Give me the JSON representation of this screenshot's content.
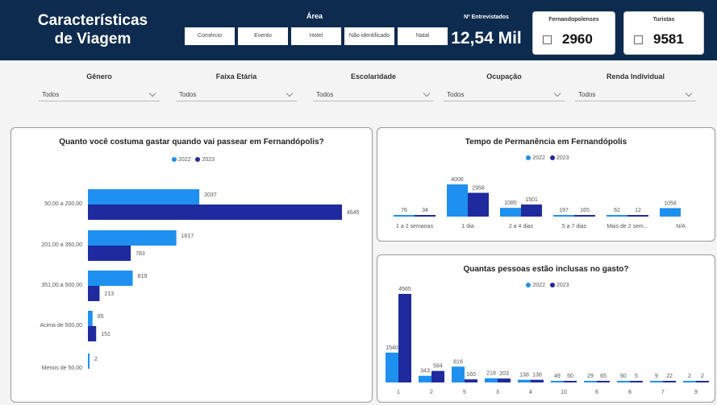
{
  "header": {
    "title": "Características de Viagem",
    "area_label": "Área",
    "area_options": [
      "Comércio",
      "Evento",
      "Hotel",
      "Não identificado",
      "Natal"
    ],
    "kpi_label": "Nº Entrevistados",
    "kpi_value": "12,54 Mil",
    "cards": [
      {
        "title": "Fernandopolenses",
        "value": "2960"
      },
      {
        "title": "Turistas",
        "value": "9581"
      }
    ]
  },
  "filters": [
    {
      "label": "Gênero",
      "value": "Todos"
    },
    {
      "label": "Faixa Etária",
      "value": "Todos"
    },
    {
      "label": "Escolaridade",
      "value": "Todos"
    },
    {
      "label": "Ocupação",
      "value": "Todos"
    },
    {
      "label": "Renda Individual",
      "value": "Todos"
    }
  ],
  "colors": {
    "series_2022": "#1e90ef",
    "series_2023": "#1f2a9e",
    "header_bg": "#0d2b4e"
  },
  "legend": [
    "2022",
    "2023"
  ],
  "chart_data": [
    {
      "type": "bar",
      "orientation": "horizontal",
      "title": "Quanto você costuma gastar quando vai passear em Fernandópolis?",
      "categories": [
        "50,00 a 200,00",
        "201,00 a 350,00",
        "351,00 a 500,00",
        "Acima de 500,00",
        "Menos de 50,00"
      ],
      "series": [
        {
          "name": "2022",
          "values": [
            2037,
            1617,
            819,
            85,
            2
          ]
        },
        {
          "name": "2023",
          "values": [
            4645,
            783,
            213,
            151,
            0
          ]
        }
      ],
      "data_labels": [
        [
          "2037",
          "1617",
          "819",
          "85",
          "2"
        ],
        [
          "4645",
          "783",
          "213",
          "151",
          ""
        ]
      ]
    },
    {
      "type": "bar",
      "title": "Tempo de Permanência em Fernandópolis",
      "categories": [
        "1 a 2 semanas",
        "1 dia",
        "2 a 4 dias",
        "5 a 7 dias",
        "Mais de 2 sem...",
        "N/A"
      ],
      "series": [
        {
          "name": "2022",
          "values": [
            76,
            4006,
            1085,
            197,
            62,
            1058
          ]
        },
        {
          "name": "2023",
          "values": [
            34,
            2958,
            1501,
            165,
            12,
            0
          ]
        }
      ],
      "data_labels": [
        [
          "76",
          "4006",
          "1085",
          "197",
          "62",
          "1058"
        ],
        [
          "34",
          "2958",
          "1501",
          "165",
          "12",
          ""
        ]
      ]
    },
    {
      "type": "bar",
      "title": "Quantas pessoas estão inclusas no gasto?",
      "categories": [
        "1",
        "2",
        "5",
        "3",
        "4",
        "10",
        "6",
        "8",
        "7",
        "9"
      ],
      "series": [
        {
          "name": "2022",
          "values": [
            1540,
            343,
            816,
            218,
            138,
            49,
            29,
            60,
            9,
            2
          ]
        },
        {
          "name": "2023",
          "values": [
            4565,
            594,
            160,
            203,
            138,
            50,
            65,
            5,
            22,
            2
          ]
        }
      ],
      "data_labels": [
        [
          "1540",
          "343",
          "816",
          "218",
          "138",
          "49",
          "29",
          "60",
          "9",
          "2"
        ],
        [
          "4565",
          "594",
          "160",
          "203",
          "138",
          "50",
          "65",
          "5",
          "22",
          "2"
        ]
      ]
    }
  ]
}
